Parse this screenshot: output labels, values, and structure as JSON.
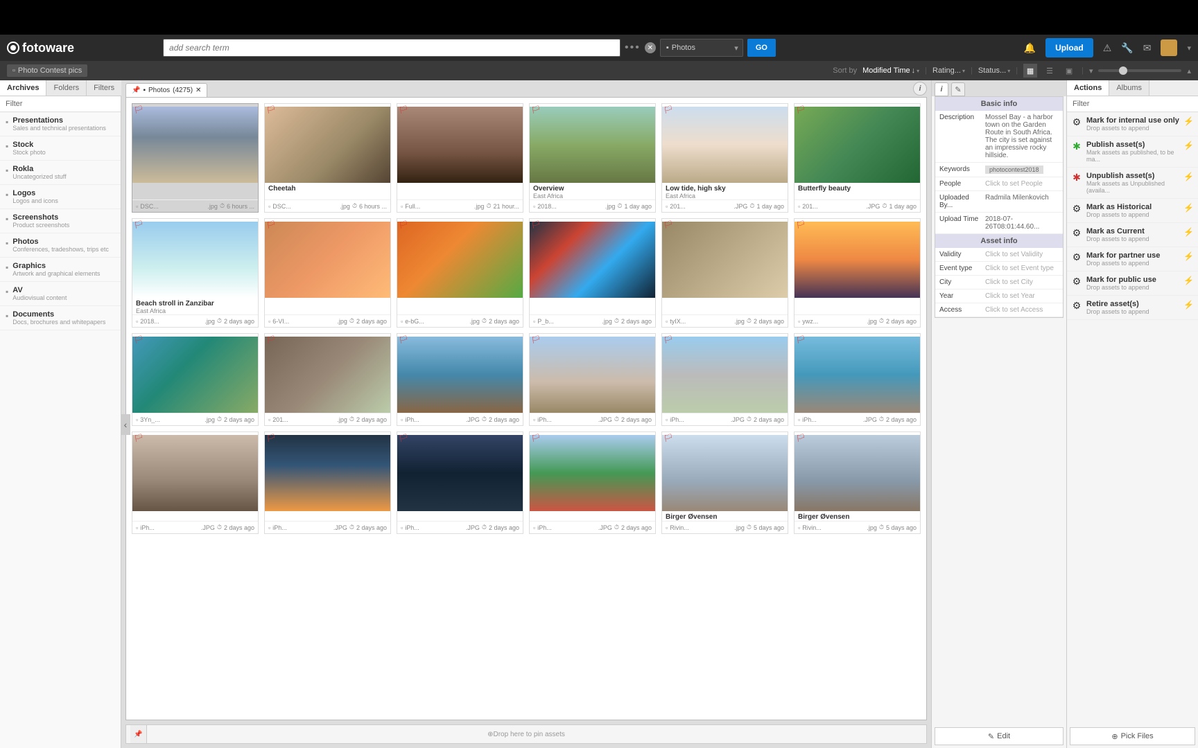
{
  "brand": "fotoware",
  "search": {
    "placeholder": "add search term"
  },
  "scope": "Photos",
  "go": "GO",
  "upload": "Upload",
  "breadcrumb": "Photo Contest pics",
  "sort": {
    "label": "Sort by",
    "value": "Modified Time"
  },
  "filters": {
    "rating": "Rating...",
    "status": "Status..."
  },
  "left_tabs": [
    "Archives",
    "Folders",
    "Filters"
  ],
  "left_filter_label": "Filter",
  "archives": [
    {
      "name": "Presentations",
      "desc": "Sales and technical presentations"
    },
    {
      "name": "Stock",
      "desc": "Stock photo"
    },
    {
      "name": "Rokla",
      "desc": "Uncategorized stuff"
    },
    {
      "name": "Logos",
      "desc": "Logos and icons"
    },
    {
      "name": "Screenshots",
      "desc": "Product screenshots"
    },
    {
      "name": "Photos",
      "desc": "Conferences, tradeshows, trips etc"
    },
    {
      "name": "Graphics",
      "desc": "Artwork and graphical elements"
    },
    {
      "name": "AV",
      "desc": "Audiovisual content"
    },
    {
      "name": "Documents",
      "desc": "Docs, brochures and whitepapers"
    }
  ],
  "center_tab": {
    "name": "Photos",
    "count": "(4275)"
  },
  "cards": [
    {
      "title": "",
      "sub": "",
      "file": "DSC...",
      "ext": ".jpg",
      "time": "6 hours ...",
      "sel": true,
      "grad": "linear-gradient(180deg,#abd 0%,#789 40%,#cb9 100%)"
    },
    {
      "title": "Cheetah",
      "sub": "",
      "file": "DSC...",
      "ext": ".jpg",
      "time": "6 hours ...",
      "grad": "linear-gradient(135deg,#db9 0%,#986 60%,#543 100%)"
    },
    {
      "title": "",
      "sub": "",
      "file": "Full...",
      "ext": ".jpg",
      "time": "21 hour...",
      "grad": "linear-gradient(180deg,#a87 0%,#754 60%,#321 100%)"
    },
    {
      "title": "Overview",
      "sub": "East Africa",
      "file": "2018...",
      "ext": ".jpg",
      "time": "1 day ago",
      "grad": "linear-gradient(180deg,#9cb 0%,#8a6 50%,#674 100%)"
    },
    {
      "title": "Low tide, high sky",
      "sub": "East Africa",
      "file": "201...",
      "ext": ".JPG",
      "time": "1 day ago",
      "grad": "linear-gradient(180deg,#cde 0%,#edc 50%,#ba8 100%)"
    },
    {
      "title": "Butterfly beauty",
      "sub": "",
      "file": "201...",
      "ext": ".JPG",
      "time": "1 day ago",
      "grad": "linear-gradient(135deg,#7a5 0%,#485 50%,#263 100%)"
    },
    {
      "title": "Beach stroll in Zanzibar",
      "sub": "East Africa",
      "file": "2018...",
      "ext": ".jpg",
      "time": "2 days ago",
      "grad": "linear-gradient(180deg,#9ce 0%,#cee 60%,#fff 100%)"
    },
    {
      "title": "",
      "sub": "",
      "file": "6-VI...",
      "ext": ".jpg",
      "time": "2 days ago",
      "grad": "linear-gradient(135deg,#c85 0%,#e96 50%,#fb7 100%)"
    },
    {
      "title": "",
      "sub": "",
      "file": "e-bG...",
      "ext": ".jpg",
      "time": "2 days ago",
      "grad": "linear-gradient(135deg,#d62 0%,#e83 40%,#5a4 100%)"
    },
    {
      "title": "",
      "sub": "",
      "file": "P_b...",
      "ext": ".jpg",
      "time": "2 days ago",
      "grad": "linear-gradient(135deg,#234 0%,#c43 30%,#3ae 60%,#123 100%)"
    },
    {
      "title": "",
      "sub": "",
      "file": "tyIX...",
      "ext": ".jpg",
      "time": "2 days ago",
      "grad": "linear-gradient(135deg,#986 0%,#ba8 50%,#dca 100%)"
    },
    {
      "title": "",
      "sub": "",
      "file": "ywz...",
      "ext": ".jpg",
      "time": "2 days ago",
      "grad": "linear-gradient(180deg,#fb5 0%,#e84 50%,#435 100%)"
    },
    {
      "title": "",
      "sub": "",
      "file": "3Yn_...",
      "ext": ".jpg",
      "time": "2 days ago",
      "grad": "linear-gradient(135deg,#49b 0%,#287 40%,#8a6 100%)"
    },
    {
      "title": "",
      "sub": "",
      "file": "201...",
      "ext": ".jpg",
      "time": "2 days ago",
      "grad": "linear-gradient(135deg,#765 0%,#987 50%,#bca 100%)"
    },
    {
      "title": "",
      "sub": "",
      "file": "iPh...",
      "ext": ".JPG",
      "time": "2 days ago",
      "grad": "linear-gradient(180deg,#8bd 0%,#48a 50%,#864 100%)"
    },
    {
      "title": "",
      "sub": "",
      "file": "iPh...",
      "ext": ".JPG",
      "time": "2 days ago",
      "grad": "linear-gradient(180deg,#ace 0%,#cba 60%,#986 100%)"
    },
    {
      "title": "",
      "sub": "",
      "file": "iPh...",
      "ext": ".JPG",
      "time": "2 days ago",
      "grad": "linear-gradient(180deg,#9ce 0%,#bbb 50%,#bca 100%)"
    },
    {
      "title": "",
      "sub": "",
      "file": "iPh...",
      "ext": ".JPG",
      "time": "2 days ago",
      "grad": "linear-gradient(180deg,#7bd 0%,#49b 50%,#987 100%)"
    },
    {
      "title": "",
      "sub": "",
      "file": "iPh...",
      "ext": ".JPG",
      "time": "2 days ago",
      "grad": "linear-gradient(180deg,#cba 0%,#987 60%,#654 100%)"
    },
    {
      "title": "",
      "sub": "",
      "file": "iPh...",
      "ext": ".JPG",
      "time": "2 days ago",
      "grad": "linear-gradient(180deg,#234 0%,#357 40%,#e94 100%)"
    },
    {
      "title": "",
      "sub": "",
      "file": "iPh...",
      "ext": ".JPG",
      "time": "2 days ago",
      "grad": "linear-gradient(180deg,#346 0%,#123 50%,#234 100%)"
    },
    {
      "title": "",
      "sub": "",
      "file": "iPh...",
      "ext": ".JPG",
      "time": "2 days ago",
      "grad": "linear-gradient(180deg,#ace 0%,#495 50%,#c54 100%)"
    },
    {
      "title": "Birger Øvensen",
      "sub": "",
      "file": "Rivin...",
      "ext": ".jpg",
      "time": "5 days ago",
      "grad": "linear-gradient(180deg,#cde 0%,#9ab 60%,#987 100%)"
    },
    {
      "title": "Birger Øvensen",
      "sub": "",
      "file": "Rivin...",
      "ext": ".jpg",
      "time": "5 days ago",
      "grad": "linear-gradient(180deg,#bcd 0%,#89a 60%,#876 100%)"
    }
  ],
  "dropzone": "Drop here to pin assets",
  "info": {
    "basic_head": "Basic info",
    "desc_label": "Description",
    "desc_val": "Mossel Bay - a harbor town on the Garden Route in South Africa. The city is set against an impressive rocky hillside.",
    "kw_label": "Keywords",
    "kw_val": "photocontest2018",
    "people_label": "People",
    "people_val": "Click to set People",
    "upby_label": "Uploaded By...",
    "upby_val": "Radmila Milenkovich",
    "uptime_label": "Upload Time",
    "uptime_val": "2018-07-26T08:01:44.60...",
    "asset_head": "Asset info",
    "validity_label": "Validity",
    "validity_val": "Click to set Validity",
    "event_label": "Event type",
    "event_val": "Click to set Event type",
    "city_label": "City",
    "city_val": "Click to set City",
    "year_label": "Year",
    "year_val": "Click to set Year",
    "access_label": "Access",
    "access_val": "Click to set Access"
  },
  "edit_label": "Edit",
  "actions_tabs": [
    "Actions",
    "Albums"
  ],
  "actions_filter_label": "Filter",
  "actions": [
    {
      "icon": "⚙",
      "color": "#333",
      "name": "Mark for internal use only",
      "desc": "Drop assets to append"
    },
    {
      "icon": "✱",
      "color": "#3a3",
      "name": "Publish asset(s)",
      "desc": "Mark assets as published, to be ma..."
    },
    {
      "icon": "✱",
      "color": "#c33",
      "name": "Unpublish asset(s)",
      "desc": "Mark assets as Unpublished (availa..."
    },
    {
      "icon": "⚙",
      "color": "#333",
      "name": "Mark as Historical",
      "desc": "Drop assets to append"
    },
    {
      "icon": "⚙",
      "color": "#333",
      "name": "Mark as Current",
      "desc": "Drop assets to append"
    },
    {
      "icon": "⚙",
      "color": "#333",
      "name": "Mark for partner use",
      "desc": "Drop assets to append"
    },
    {
      "icon": "⚙",
      "color": "#333",
      "name": "Mark for public use",
      "desc": "Drop assets to append"
    },
    {
      "icon": "⚙",
      "color": "#333",
      "name": "Retire asset(s)",
      "desc": "Drop assets to append"
    }
  ],
  "pick_label": "Pick Files"
}
